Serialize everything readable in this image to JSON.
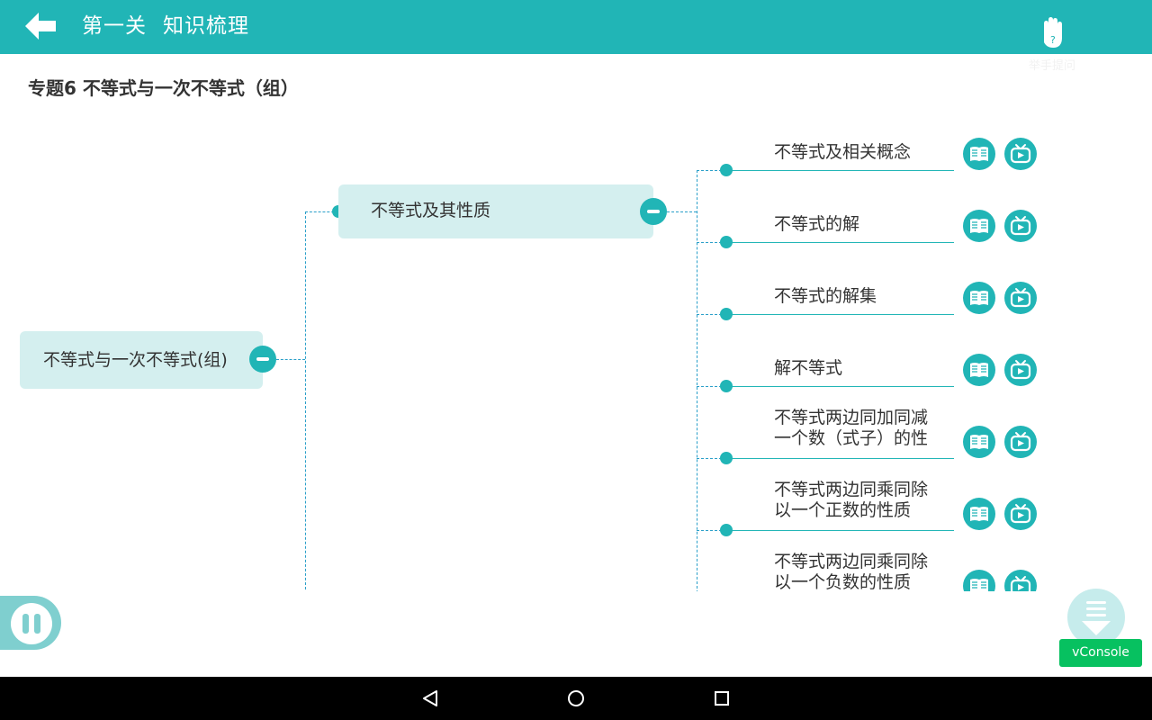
{
  "header": {
    "back_icon": "arrow-left-icon",
    "title_level": "第一关",
    "title_section": "知识梳理",
    "help_label": "举手提问",
    "help_icon": "raised-hand-icon"
  },
  "subject_title": "专题6 不等式与一次不等式（组）",
  "mindmap": {
    "root": {
      "label": "不等式与一次不等式(组)"
    },
    "branch": {
      "label": "不等式及其性质"
    },
    "leaves": [
      {
        "line1": "不等式及相关概念",
        "line2": ""
      },
      {
        "line1": "不等式的解",
        "line2": ""
      },
      {
        "line1": "不等式的解集",
        "line2": ""
      },
      {
        "line1": "解不等式",
        "line2": ""
      },
      {
        "line1": "不等式两边同加同减",
        "line2": "一个数（式子）的性"
      },
      {
        "line1": "不等式两边同乘同除",
        "line2": "以一个正数的性质"
      },
      {
        "line1": "不等式两边同乘同除",
        "line2": "以一个负数的性质"
      }
    ],
    "leaf_icons": {
      "book": "open-book-icon",
      "video": "tv-video-icon"
    }
  },
  "controls": {
    "pause_icon": "pause-icon",
    "scroll_down_icon": "scroll-down-icon",
    "vconsole_label": "vConsole"
  },
  "android_nav": {
    "back": "nav-back-icon",
    "home": "nav-home-icon",
    "recents": "nav-recents-icon"
  },
  "colors": {
    "primary": "#21b5b6",
    "node_bg": "#d4efef",
    "vconsole": "#07c160"
  }
}
